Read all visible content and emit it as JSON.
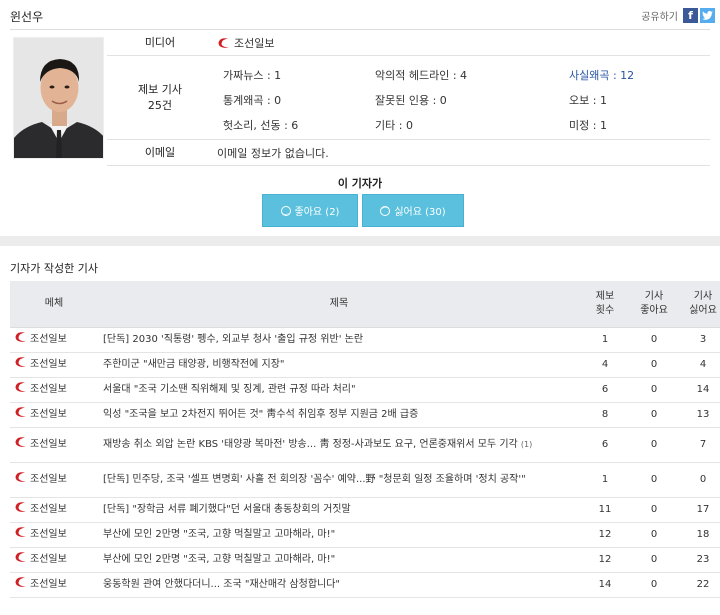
{
  "reporter": {
    "name": "윈선우",
    "share_label": "공유하기",
    "fb_icon": "f",
    "tw_icon": "t"
  },
  "info": {
    "media_label": "미디어",
    "media_name": "조선일보",
    "reports_label_line1": "제보 기사",
    "reports_label_line2": "25건",
    "stats": {
      "s1": "가짜뉴스 : 1",
      "s2": "악의적 헤드라인 : 4",
      "s3": "사실왜곡 : 12",
      "s4": "통계왜곡 : 0",
      "s5": "잘못된 인용 : 0",
      "s6": "오보 : 1",
      "s7": "헛소리, 선동 : 6",
      "s8": "기타 : 0",
      "s9": "미정 : 1"
    },
    "email_label": "이메일",
    "email_value": "이메일 정보가 없습니다."
  },
  "vote": {
    "title": "이 기자가",
    "like_label": "좋아요 (2)",
    "dislike_label": "싫어요 (30)"
  },
  "articles": {
    "title": "기자가 작성한 기사",
    "headers": {
      "media": "메체",
      "title": "제목",
      "reports_1": "제보",
      "reports_2": "횟수",
      "likes_1": "기사",
      "likes_2": "좋아요",
      "dislikes_1": "기사",
      "dislikes_2": "싫어요"
    },
    "rows": [
      {
        "media": "조선일보",
        "title": "[단독] 2030 '직통령' 펭수, 외교부 청사 '출입 규정 위반' 논란",
        "reports": "1",
        "likes": "0",
        "dislikes": "3"
      },
      {
        "media": "조선일보",
        "title": "주한미군 \"새만금 태양광, 비행작전에 지장\"",
        "reports": "4",
        "likes": "0",
        "dislikes": "4"
      },
      {
        "media": "조선일보",
        "title": "서울대 \"조국 기소땐 직위해제 및 징계, 관련 규정 따라 처리\"",
        "reports": "6",
        "likes": "0",
        "dislikes": "14"
      },
      {
        "media": "조선일보",
        "title": "익성 \"조국을 보고 2차전지 뛰어든 것\" 靑수석 취임후 정부 지원금 2배 급증",
        "reports": "8",
        "likes": "0",
        "dislikes": "13"
      },
      {
        "media": "조선일보",
        "title": "재방송 취소 외압 논란 KBS '태양광 복마전' 방송... 靑 정정-사과보도 요구, 언론중재위서 모두 기각",
        "title_extra": "(1)",
        "reports": "6",
        "likes": "0",
        "dislikes": "7"
      },
      {
        "media": "조선일보",
        "title": "[단독] 민주당, 조국 '셀프 변명회' 사흘 전 회의장 '꼼수' 예약...野 \"청문회 일정 조율하며 '정치 공작'\"",
        "reports": "1",
        "likes": "0",
        "dislikes": "0"
      },
      {
        "media": "조선일보",
        "title": "[단독] \"장학금 서류 폐기했다\"던 서울대 총동창회의 거짓말",
        "reports": "11",
        "likes": "0",
        "dislikes": "17"
      },
      {
        "media": "조선일보",
        "title": "부산에 모인 2만명 \"조국, 고향 먹칠말고 고마해라, 마!\"",
        "reports": "12",
        "likes": "0",
        "dislikes": "18"
      },
      {
        "media": "조선일보",
        "title": "부산에 모인 2만명 \"조국, 고향 먹칠말고 고마해라, 마!\"",
        "reports": "12",
        "likes": "0",
        "dislikes": "23"
      },
      {
        "media": "조선일보",
        "title": "웅동학원 관여 안했다더니... 조국 \"재산매각 삼청합니다\"",
        "reports": "14",
        "likes": "0",
        "dislikes": "22"
      }
    ]
  },
  "colors": {
    "accent_blue": "#2753a6",
    "button_blue": "#5ac0de",
    "logo_red": "#d11f26",
    "header_bg": "#e9ebee"
  },
  "icons": {
    "photo": "reporter-photo",
    "logo": "chosun-logo-icon",
    "smile": "smile-icon",
    "frown": "frown-icon"
  }
}
